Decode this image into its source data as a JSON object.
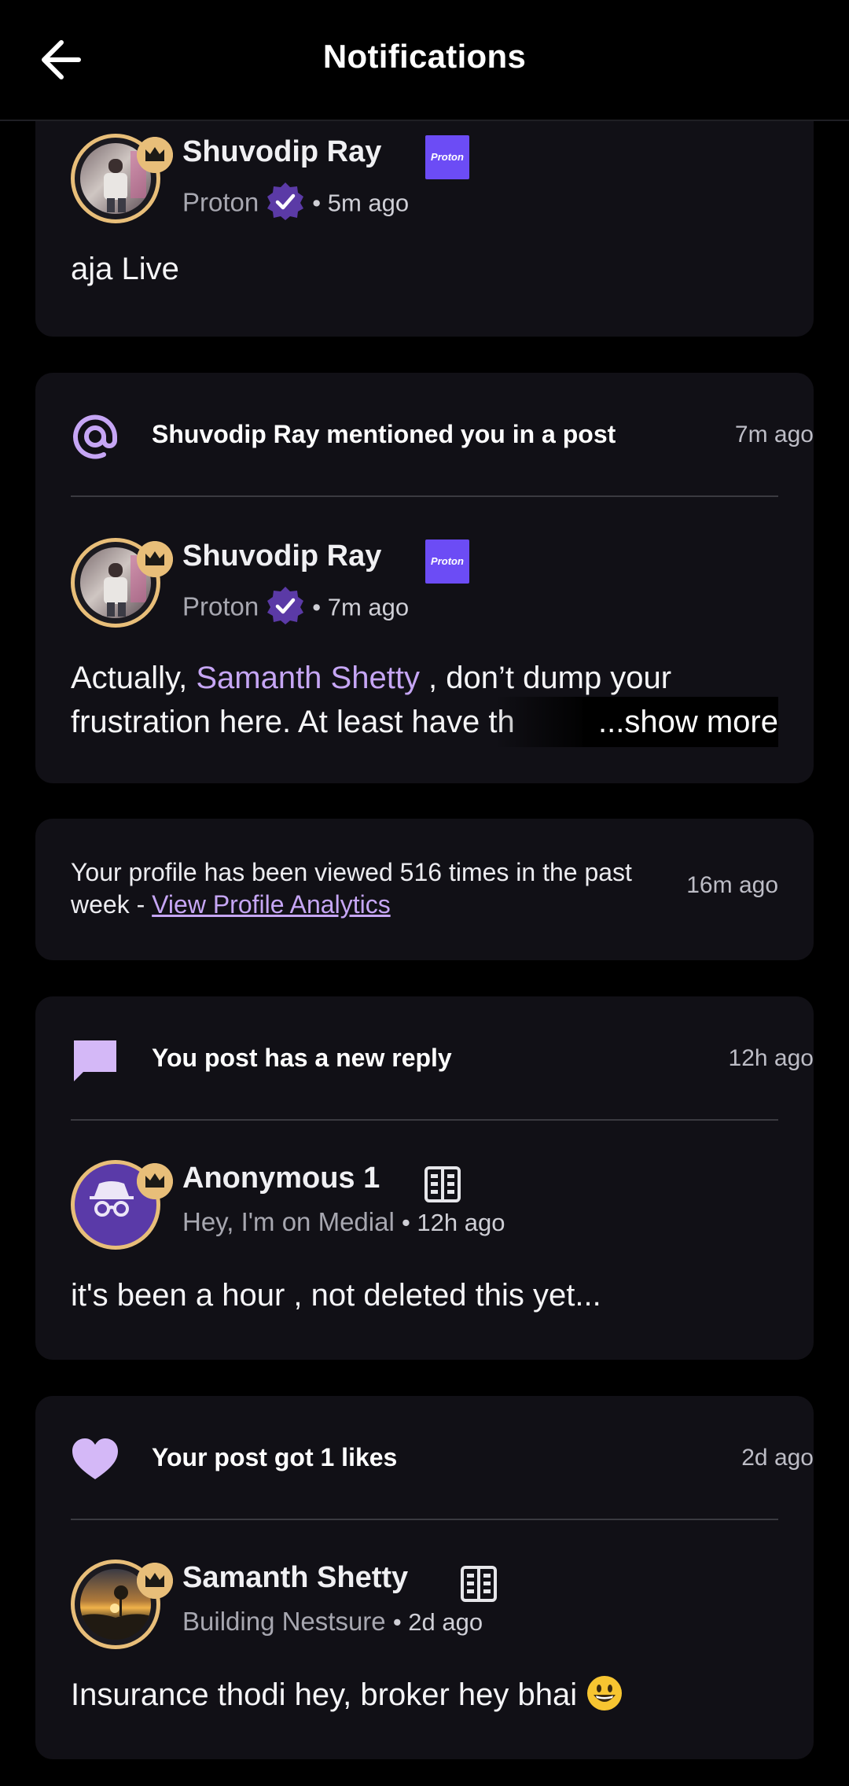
{
  "header": {
    "title": "Notifications"
  },
  "cards": [
    {
      "author": {
        "name": "Shuvodip Ray",
        "company_badge": "Proton",
        "subtitle": "Proton",
        "time": "• 5m ago"
      },
      "body": "aja Live"
    },
    {
      "notification": {
        "text": "Shuvodip Ray mentioned you in a post",
        "time": "7m ago",
        "icon": "at-icon"
      },
      "author": {
        "name": "Shuvodip Ray",
        "company_badge": "Proton",
        "subtitle": "Proton",
        "time": "• 7m ago"
      },
      "body_line1_prefix": "Actually, ",
      "body_mention": "Samanth Shetty",
      "body_line1_suffix": " , don’t dump your",
      "body_line2": "frustration here. At least have th",
      "show_more": "...show more"
    },
    {
      "text_prefix": "Your profile has been viewed 516 times in the past week - ",
      "link": "View Profile Analytics",
      "time": "16m ago"
    },
    {
      "notification": {
        "text": "You post has a new reply",
        "time": "12h ago",
        "icon": "chat-bubble-icon"
      },
      "author": {
        "name": "Anonymous 1",
        "subtitle": "Hey, I'm on Medial",
        "time": "• 12h ago"
      },
      "body": "it's been a hour , not deleted this yet..."
    },
    {
      "notification": {
        "text": "Your post got 1 likes",
        "time": "2d ago",
        "icon": "heart-icon"
      },
      "author": {
        "name": "Samanth Shetty",
        "subtitle": "Building Nestsure",
        "time": "• 2d ago"
      },
      "body": "Insurance thodi hey, broker hey bhai"
    }
  ],
  "colors": {
    "accent": "#c6a6f5",
    "crown": "#e8be79",
    "verified": "#5b3aa6",
    "card": "#111016",
    "badge": "#6c4cf5"
  }
}
